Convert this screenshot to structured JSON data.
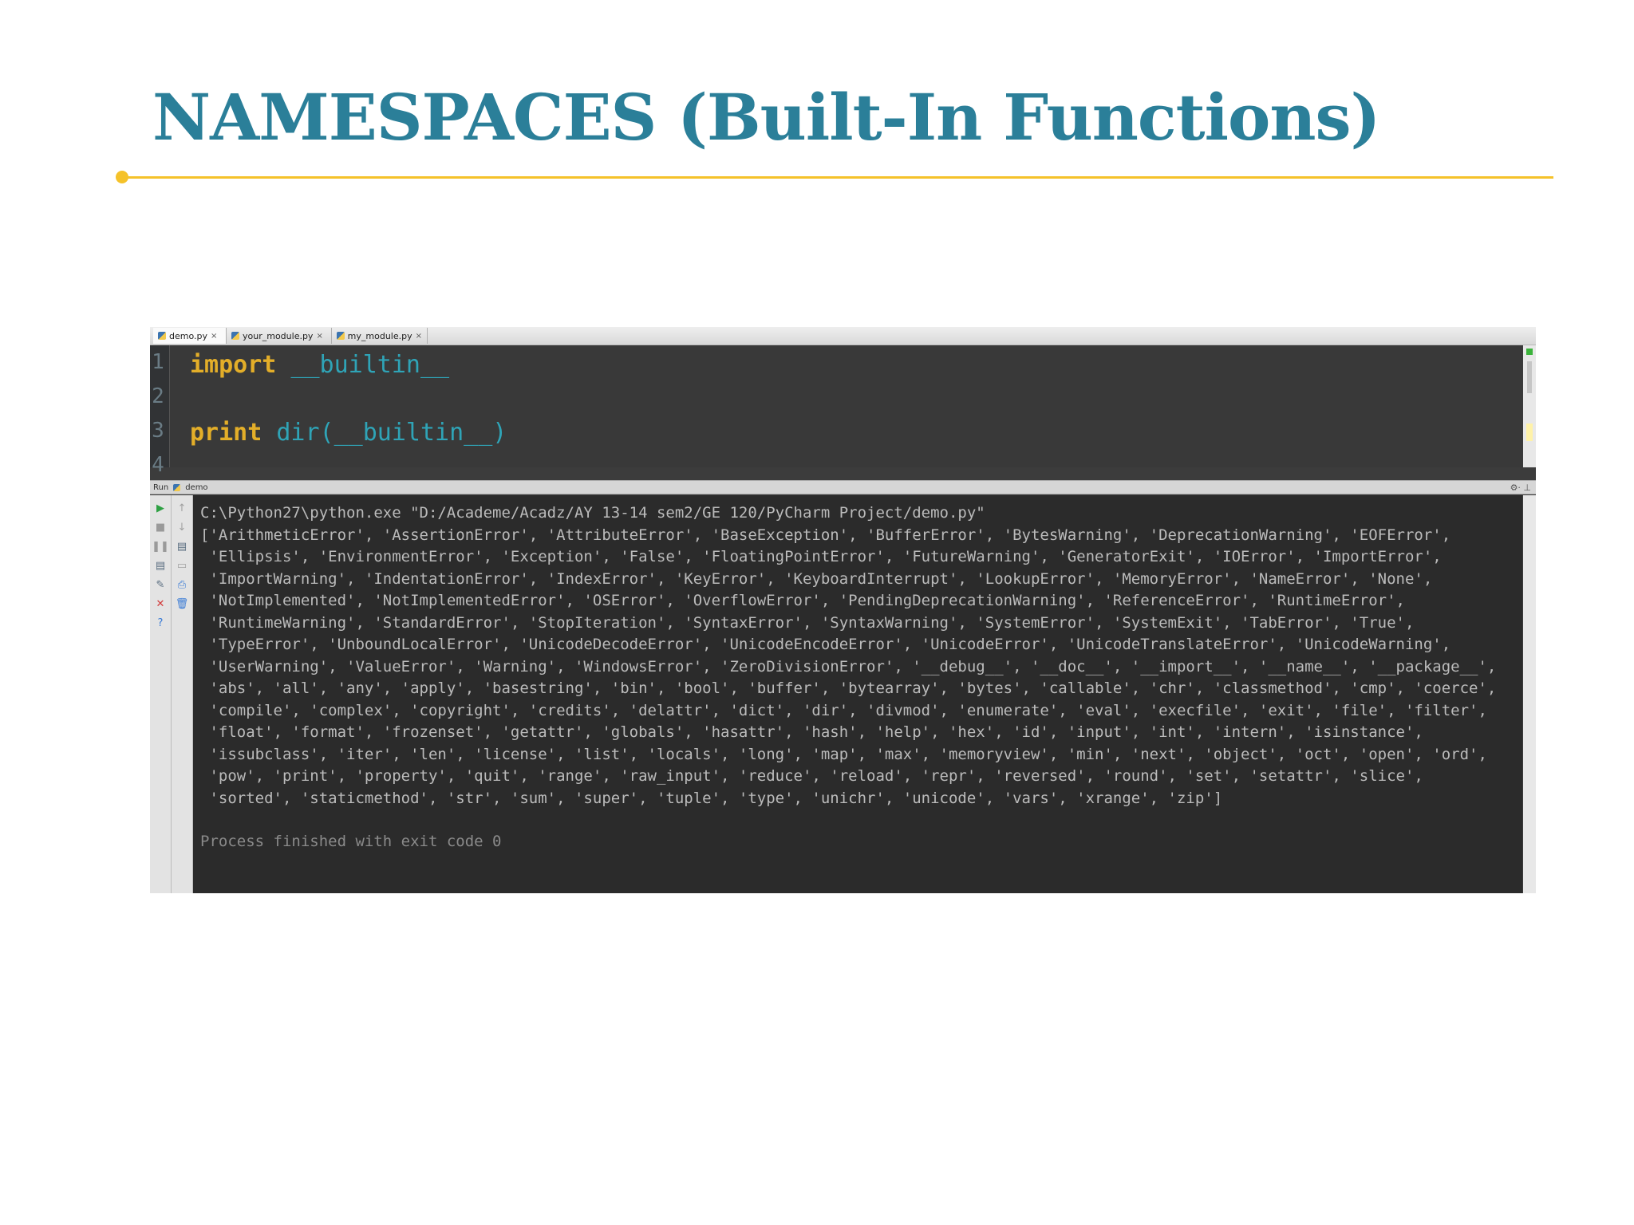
{
  "slide": {
    "title": "NAMESPACES (Built-In Functions)"
  },
  "ide": {
    "tabs": [
      {
        "label": "demo.py",
        "active": true
      },
      {
        "label": "your_module.py",
        "active": false
      },
      {
        "label": "my_module.py",
        "active": false
      }
    ],
    "tab_close_glyph": "×",
    "editor": {
      "line_numbers": [
        "1",
        "2",
        "3",
        "4"
      ],
      "line1_keyword": "import",
      "line1_name": "__builtin__",
      "line3_keyword": "print",
      "line3_rest": "dir(__builtin__)"
    },
    "run_panel": {
      "label": "Run",
      "config": "demo",
      "tools_glyph": "⚙· ⊥"
    },
    "console": {
      "lines": [
        "C:\\Python27\\python.exe \"D:/Academe/Acadz/AY 13-14 sem2/GE 120/PyCharm Project/demo.py\"",
        "['ArithmeticError', 'AssertionError', 'AttributeError', 'BaseException', 'BufferError', 'BytesWarning', 'DeprecationWarning', 'EOFError',",
        " 'Ellipsis', 'EnvironmentError', 'Exception', 'False', 'FloatingPointError', 'FutureWarning', 'GeneratorExit', 'IOError', 'ImportError',",
        " 'ImportWarning', 'IndentationError', 'IndexError', 'KeyError', 'KeyboardInterrupt', 'LookupError', 'MemoryError', 'NameError', 'None',",
        " 'NotImplemented', 'NotImplementedError', 'OSError', 'OverflowError', 'PendingDeprecationWarning', 'ReferenceError', 'RuntimeError',",
        " 'RuntimeWarning', 'StandardError', 'StopIteration', 'SyntaxError', 'SyntaxWarning', 'SystemError', 'SystemExit', 'TabError', 'True',",
        " 'TypeError', 'UnboundLocalError', 'UnicodeDecodeError', 'UnicodeEncodeError', 'UnicodeError', 'UnicodeTranslateError', 'UnicodeWarning',",
        " 'UserWarning', 'ValueError', 'Warning', 'WindowsError', 'ZeroDivisionError', '__debug__', '__doc__', '__import__', '__name__', '__package__',",
        " 'abs', 'all', 'any', 'apply', 'basestring', 'bin', 'bool', 'buffer', 'bytearray', 'bytes', 'callable', 'chr', 'classmethod', 'cmp', 'coerce',",
        " 'compile', 'complex', 'copyright', 'credits', 'delattr', 'dict', 'dir', 'divmod', 'enumerate', 'eval', 'execfile', 'exit', 'file', 'filter',",
        " 'float', 'format', 'frozenset', 'getattr', 'globals', 'hasattr', 'hash', 'help', 'hex', 'id', 'input', 'int', 'intern', 'isinstance',",
        " 'issubclass', 'iter', 'len', 'license', 'list', 'locals', 'long', 'map', 'max', 'memoryview', 'min', 'next', 'object', 'oct', 'open', 'ord',",
        " 'pow', 'print', 'property', 'quit', 'range', 'raw_input', 'reduce', 'reload', 'repr', 'reversed', 'round', 'set', 'setattr', 'slice',",
        " 'sorted', 'staticmethod', 'str', 'sum', 'super', 'tuple', 'type', 'unichr', 'unicode', 'vars', 'xrange', 'zip']"
      ],
      "exit_message": "Process finished with exit code 0"
    },
    "left_tools": [
      {
        "name": "rerun-icon",
        "glyph": "▶",
        "color": "#2ea043"
      },
      {
        "name": "stop-icon",
        "glyph": "■",
        "color": "#9a9a9a"
      },
      {
        "name": "pause-icon",
        "glyph": "❚❚",
        "color": "#9a9a9a"
      },
      {
        "name": "restore-layout-icon",
        "glyph": "▤",
        "color": "#5a6e80"
      },
      {
        "name": "pin-icon",
        "glyph": "✎",
        "color": "#5a6e80"
      },
      {
        "name": "close-icon",
        "glyph": "✕",
        "color": "#d23b3b"
      },
      {
        "name": "help-icon",
        "glyph": "?",
        "color": "#3a7bd5"
      }
    ],
    "second_tools": [
      {
        "name": "up-arrow-icon",
        "glyph": "↑",
        "color": "#a0a0a0"
      },
      {
        "name": "down-arrow-icon",
        "glyph": "↓",
        "color": "#a0a0a0"
      },
      {
        "name": "soft-wrap-icon",
        "glyph": "▤",
        "color": "#5a6e80"
      },
      {
        "name": "scroll-end-icon",
        "glyph": "▭",
        "color": "#a0a0a0"
      },
      {
        "name": "print-icon",
        "glyph": "⎙",
        "color": "#3a7bd5"
      },
      {
        "name": "clear-all-icon",
        "glyph": "🗑",
        "color": "#3a7bd5"
      }
    ]
  }
}
